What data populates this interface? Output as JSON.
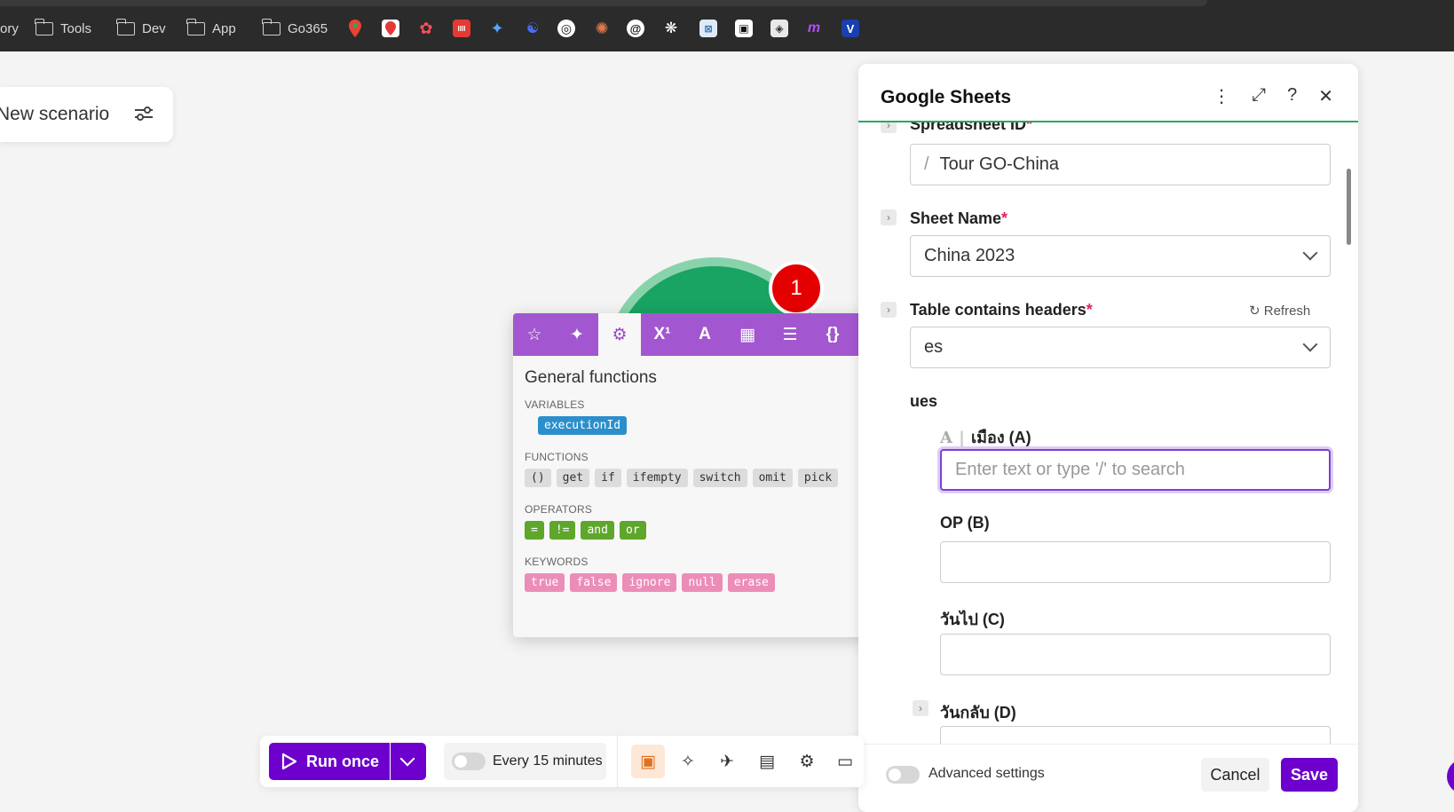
{
  "bookmarks": {
    "partial_label": "ory",
    "folders": [
      "Tools",
      "Dev",
      "App",
      "Go365"
    ]
  },
  "scenario": {
    "name": "New scenario"
  },
  "module": {
    "badge_count": "1"
  },
  "function_picker": {
    "title": "General functions",
    "sections": {
      "variables": {
        "label": "VARIABLES",
        "items": [
          "executionId"
        ]
      },
      "functions": {
        "label": "FUNCTIONS",
        "items": [
          "()",
          "get",
          "if",
          "ifempty",
          "switch",
          "omit",
          "pick"
        ]
      },
      "operators": {
        "label": "OPERATORS",
        "items": [
          "=",
          "!=",
          "and",
          "or"
        ]
      },
      "keywords": {
        "label": "KEYWORDS",
        "items": [
          "true",
          "false",
          "ignore",
          "null",
          "erase"
        ]
      }
    },
    "help": "?",
    "close": "×"
  },
  "panel": {
    "title": "Google Sheets",
    "spreadsheet_id": {
      "label": "Spreadsheet ID",
      "value": "Tour GO-China"
    },
    "sheet_name": {
      "label": "Sheet Name",
      "value": "China 2023"
    },
    "headers": {
      "label": "Table contains headers",
      "refresh": "Refresh",
      "value": "es"
    },
    "values_label": "ues",
    "column_a": {
      "label": "เมือง (A)",
      "placeholder": "Enter text or type '/' to search"
    },
    "column_b": {
      "label": "OP (B)"
    },
    "column_c": {
      "label": "วันไป (C)"
    },
    "column_d": {
      "label": "วันกลับ (D)"
    },
    "advanced": "Advanced settings",
    "cancel": "Cancel",
    "save": "Save"
  },
  "toolbar": {
    "run_once": "Run once",
    "schedule": "Every 15 minutes"
  }
}
